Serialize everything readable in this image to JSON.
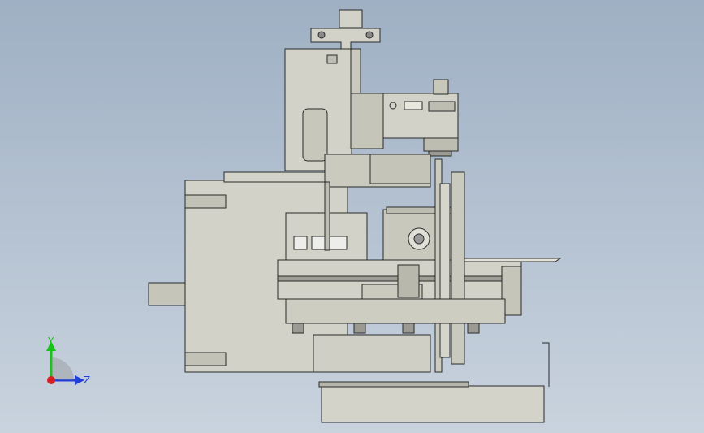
{
  "viewport": {
    "background_top": "#9fb0c4",
    "background_bottom": "#c9d3de"
  },
  "model": {
    "body_color": "#d2d2c8",
    "shade_color": "#b9b9ae",
    "edge_color": "#2a2a2a"
  },
  "triad": {
    "y_label": "Y",
    "z_label": "Z",
    "y_color": "#19c219",
    "z_color": "#1f3fd8",
    "origin_color": "#d81f1f"
  }
}
